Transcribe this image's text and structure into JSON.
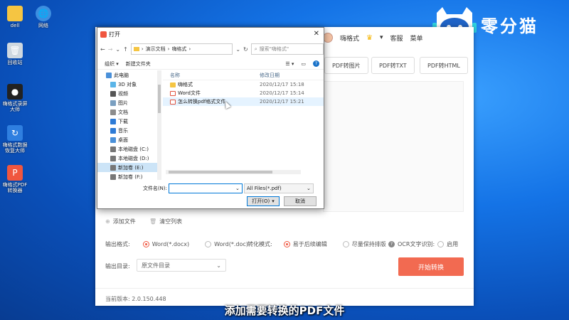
{
  "desktop": {
    "icons": [
      {
        "label": "dell"
      },
      {
        "label": "网络"
      },
      {
        "label": "回收站"
      },
      {
        "label": "嗨格式录屏大师"
      },
      {
        "label": "嗨格式数据恢复大师"
      },
      {
        "label": "嗨格式PDF转换器"
      }
    ]
  },
  "brand": {
    "name": "零分猫"
  },
  "app": {
    "user": "嗨格式",
    "support": "客服",
    "menu": "菜单",
    "tabs": [
      "PDF转图片",
      "PDF转TXT",
      "PDF转HTML"
    ],
    "add_file": "添加文件",
    "clear_list": "清空列表",
    "output_format_label": "输出格式:",
    "format_options": [
      {
        "label": "Word(*.docx)",
        "selected": true
      },
      {
        "label": "Word(*.doc)",
        "selected": false
      }
    ],
    "convert_mode_label": "转化模式:",
    "mode_options": [
      {
        "label": "易于后续编辑",
        "selected": true
      },
      {
        "label": "尽量保持排版",
        "selected": false
      }
    ],
    "ocr_label": "OCR文字识别:",
    "ocr_option": "启用",
    "output_dir_label": "输出目录:",
    "output_dir_value": "原文件目录",
    "start_button": "开始转换",
    "version": "当前版本: 2.0.150.448"
  },
  "dialog": {
    "title": "打开",
    "path": [
      "演示文档",
      "嗨格式"
    ],
    "search_placeholder": "搜索\"嗨格式\"",
    "organize": "组织 ▾",
    "new_folder": "新建文件夹",
    "nav_items": [
      {
        "label": "此电脑",
        "root": true,
        "color": "#4a90d9"
      },
      {
        "label": "3D 对象",
        "color": "#5bb5e8"
      },
      {
        "label": "视频",
        "color": "#555"
      },
      {
        "label": "图片",
        "color": "#7a9fc0"
      },
      {
        "label": "文档",
        "color": "#8c8c8c"
      },
      {
        "label": "下载",
        "color": "#2e7bd6"
      },
      {
        "label": "音乐",
        "color": "#2e7bd6"
      },
      {
        "label": "桌面",
        "color": "#4a90d9"
      },
      {
        "label": "本地磁盘 (C:)",
        "color": "#777"
      },
      {
        "label": "本地磁盘 (D:)",
        "color": "#777"
      },
      {
        "label": "新加卷 (E:)",
        "color": "#777",
        "selected": true
      },
      {
        "label": "新加卷 (F:)",
        "color": "#777"
      }
    ],
    "columns": {
      "name": "名称",
      "date": "修改日期"
    },
    "files": [
      {
        "name": "嗨格式",
        "date": "2020/12/17 15:18",
        "type": "folder"
      },
      {
        "name": "Word文件",
        "date": "2020/12/17 15:14",
        "type": "pdf"
      },
      {
        "name": "怎么转换pdf格式文件",
        "date": "2020/12/17 15:21",
        "type": "pdf",
        "hover": true
      }
    ],
    "filename_label": "文件名(N):",
    "filename_value": "",
    "filter": "All Files(*.pdf)",
    "open_button": "打开(O)",
    "cancel_button": "取消"
  },
  "subtitle": "添加需要转换的PDF文件",
  "colors": {
    "accent": "#f26a51",
    "selection": "#cce4f7",
    "desktop": "#1473e6"
  }
}
